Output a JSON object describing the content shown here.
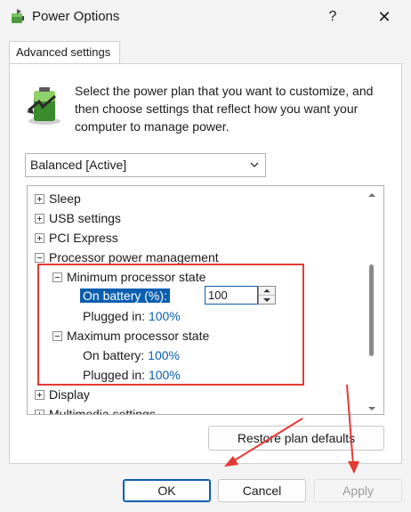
{
  "window": {
    "title": "Power Options",
    "help_label": "?",
    "close_label": "✕"
  },
  "tab": {
    "label": "Advanced settings"
  },
  "description": "Select the power plan that you want to customize, and then choose settings that reflect how you want your computer to manage power.",
  "plan_select": {
    "value": "Balanced [Active]"
  },
  "tree": {
    "sleep": "Sleep",
    "usb": "USB settings",
    "pci": "PCI Express",
    "ppm": "Processor power management",
    "min_state": "Minimum processor state",
    "min_on_battery_label": "On battery (%):",
    "min_on_battery_value": "100",
    "min_plugged_label": "Plugged in:",
    "min_plugged_value": "100%",
    "max_state": "Maximum processor state",
    "max_on_battery_label": "On battery:",
    "max_on_battery_value": "100%",
    "max_plugged_label": "Plugged in:",
    "max_plugged_value": "100%",
    "display": "Display",
    "multimedia": "Multimedia settings"
  },
  "buttons": {
    "restore": "Restore plan defaults",
    "ok": "OK",
    "cancel": "Cancel",
    "apply": "Apply"
  },
  "colors": {
    "accent": "#0a5fb0",
    "annotation": "#e53935"
  }
}
